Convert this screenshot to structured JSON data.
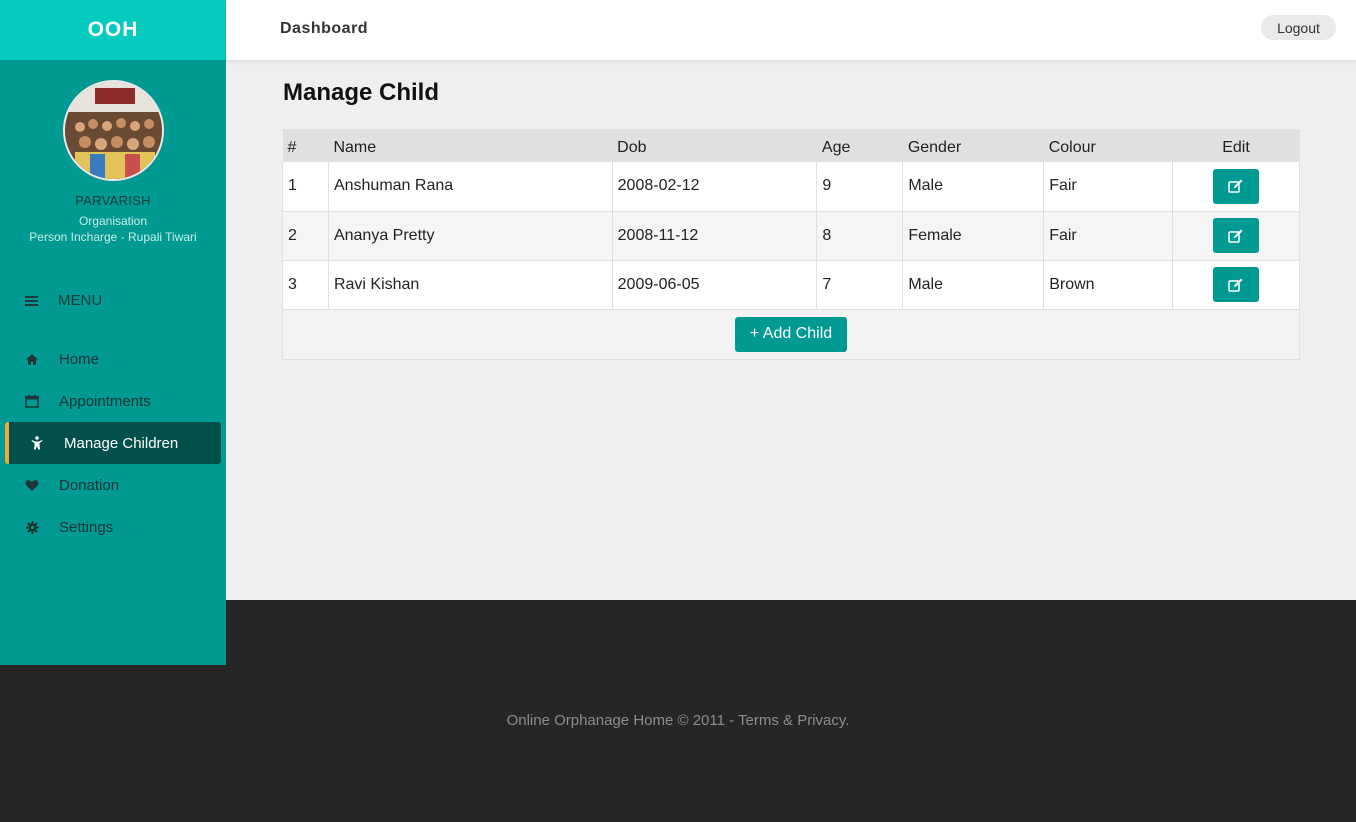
{
  "brand": "OOH",
  "profile": {
    "name": "PARVARISH",
    "type": "Organisation",
    "person": "Person Incharge - Rupali Tiwari"
  },
  "menu": {
    "label": "MENU",
    "items": [
      {
        "label": "Home",
        "icon": "home-icon"
      },
      {
        "label": "Appointments",
        "icon": "calendar-icon"
      },
      {
        "label": "Manage Children",
        "icon": "child-icon",
        "active": true
      },
      {
        "label": "Donation",
        "icon": "heart-icon"
      },
      {
        "label": "Settings",
        "icon": "gear-icon"
      }
    ]
  },
  "topbar": {
    "title": "Dashboard",
    "logout_label": "Logout"
  },
  "page": {
    "title": "Manage Child"
  },
  "table": {
    "headers": [
      "#",
      "Name",
      "Dob",
      "Age",
      "Gender",
      "Colour",
      "Edit"
    ],
    "rows": [
      {
        "num": "1",
        "name": "Anshuman Rana",
        "dob": "2008-02-12",
        "age": "9",
        "gender": "Male",
        "colour": "Fair"
      },
      {
        "num": "2",
        "name": "Ananya Pretty",
        "dob": "2008-11-12",
        "age": "8",
        "gender": "Female",
        "colour": "Fair"
      },
      {
        "num": "3",
        "name": "Ravi Kishan",
        "dob": "2009-06-05",
        "age": "7",
        "gender": "Male",
        "colour": "Brown"
      }
    ],
    "add_label": "+ Add Child"
  },
  "footer": {
    "text": "Online Orphanage Home © 2011 - Terms & Privacy."
  },
  "colors": {
    "sidebar": "#009a93",
    "brand": "#04cbbd",
    "active_item": "#02504b",
    "active_marker": "#f4a53b",
    "footer": "#262626"
  }
}
